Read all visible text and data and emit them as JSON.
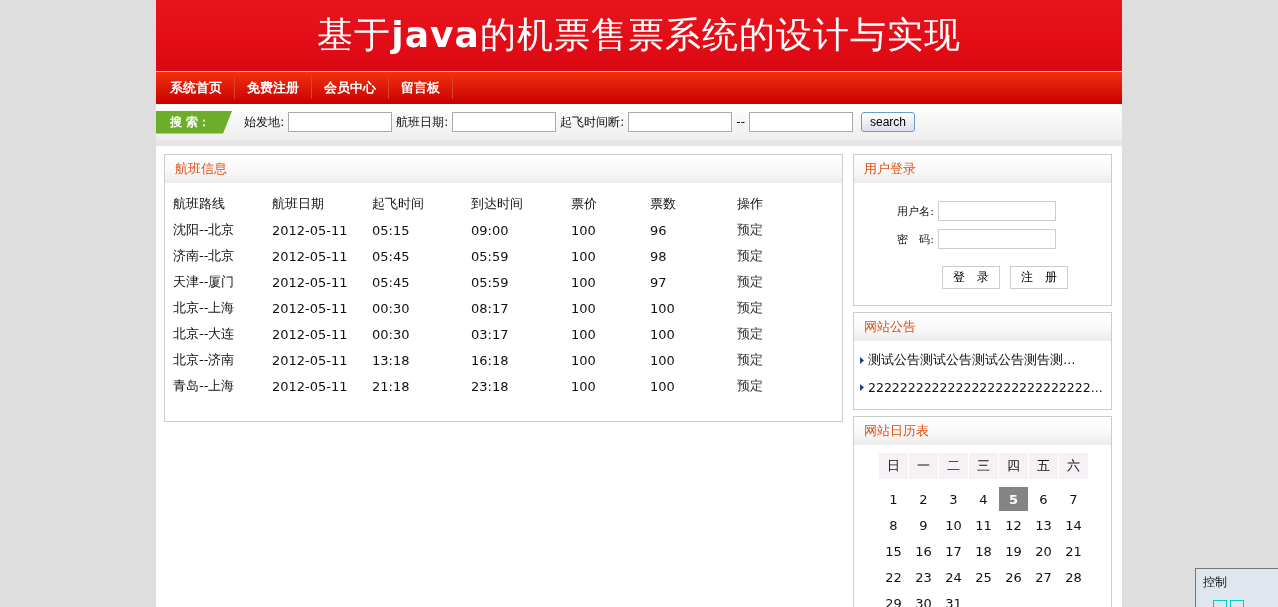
{
  "header": {
    "title": "基于**java**的机票售票系统的设计与实现"
  },
  "nav": [
    "系统首页",
    "免费注册",
    "会员中心",
    "留言板"
  ],
  "search": {
    "tag": "搜 索：",
    "fields": [
      {
        "label": "始发地:"
      },
      {
        "label": "航班日期:"
      },
      {
        "label": "起飞时间断:"
      },
      {
        "label": "--"
      }
    ],
    "button": "search"
  },
  "flights": {
    "title": "航班信息",
    "columns": [
      "航班路线",
      "航班日期",
      "起飞时间",
      "到达时间",
      "票价",
      "票数",
      "操作"
    ],
    "rows": [
      [
        "沈阳--北京",
        "2012-05-11",
        "05:15",
        "09:00",
        "100",
        "96",
        "预定"
      ],
      [
        "济南--北京",
        "2012-05-11",
        "05:45",
        "05:59",
        "100",
        "98",
        "预定"
      ],
      [
        "天津--厦门",
        "2012-05-11",
        "05:45",
        "05:59",
        "100",
        "97",
        "预定"
      ],
      [
        "北京--上海",
        "2012-05-11",
        "00:30",
        "08:17",
        "100",
        "100",
        "预定"
      ],
      [
        "北京--大连",
        "2012-05-11",
        "00:30",
        "03:17",
        "100",
        "100",
        "预定"
      ],
      [
        "北京--济南",
        "2012-05-11",
        "13:18",
        "16:18",
        "100",
        "100",
        "预定"
      ],
      [
        "青岛--上海",
        "2012-05-11",
        "21:18",
        "23:18",
        "100",
        "100",
        "预定"
      ]
    ]
  },
  "login": {
    "title": "用户登录",
    "fields": [
      {
        "label": "用户名:"
      },
      {
        "label": "密　码:"
      }
    ],
    "buttons": [
      "登　录",
      "注　册"
    ]
  },
  "notices": {
    "title": "网站公告",
    "items": [
      "测试公告测试公告测试公告测告测…",
      "2222222222222222222222222222..."
    ]
  },
  "calendar": {
    "title": "网站日历表",
    "weekdays": [
      "日",
      "一",
      "二",
      "三",
      "四",
      "五",
      "六"
    ],
    "days": [
      {
        "day": "1",
        "selected": false
      },
      {
        "day": "2",
        "selected": false
      },
      {
        "day": "3",
        "selected": false
      },
      {
        "day": "4",
        "selected": false
      },
      {
        "day": "5",
        "selected": true
      },
      {
        "day": "6",
        "selected": false
      },
      {
        "day": "7",
        "selected": false
      },
      {
        "day": "8",
        "selected": false
      },
      {
        "day": "9",
        "selected": false
      },
      {
        "day": "10",
        "selected": false
      },
      {
        "day": "11",
        "selected": false
      },
      {
        "day": "12",
        "selected": false
      },
      {
        "day": "13",
        "selected": false
      },
      {
        "day": "14",
        "selected": false
      },
      {
        "day": "15",
        "selected": false
      },
      {
        "day": "16",
        "selected": false
      },
      {
        "day": "17",
        "selected": false
      },
      {
        "day": "18",
        "selected": false
      },
      {
        "day": "19",
        "selected": false
      },
      {
        "day": "20",
        "selected": false
      },
      {
        "day": "21",
        "selected": false
      },
      {
        "day": "22",
        "selected": false
      },
      {
        "day": "23",
        "selected": false
      },
      {
        "day": "24",
        "selected": false
      },
      {
        "day": "25",
        "selected": false
      },
      {
        "day": "26",
        "selected": false
      },
      {
        "day": "27",
        "selected": false
      },
      {
        "day": "28",
        "selected": false
      },
      {
        "day": "29",
        "selected": false
      },
      {
        "day": "30",
        "selected": false
      },
      {
        "day": "31",
        "selected": false
      }
    ]
  },
  "control_window": {
    "title": "控制"
  }
}
